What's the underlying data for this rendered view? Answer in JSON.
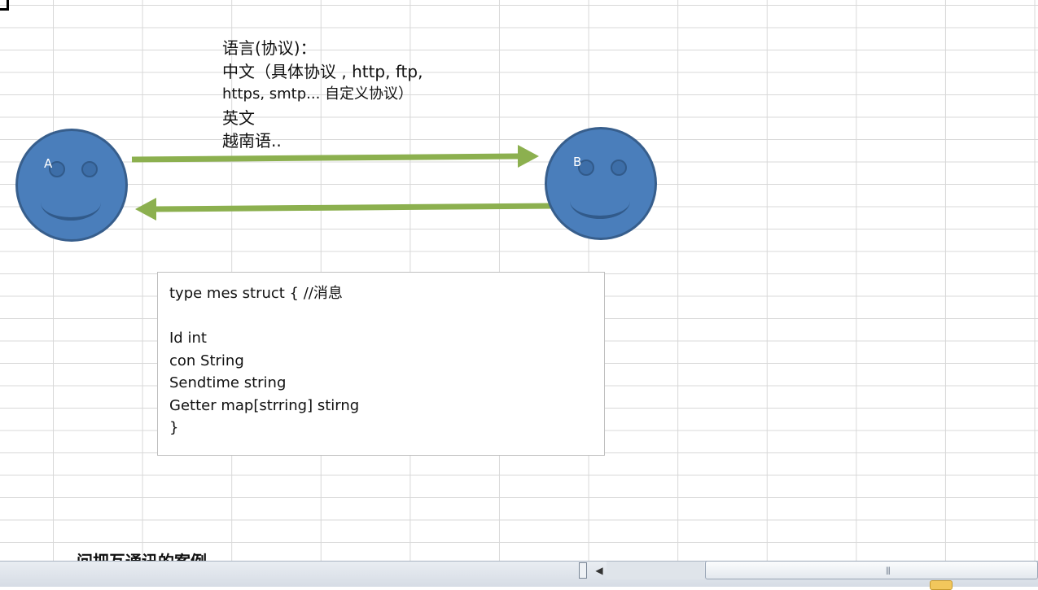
{
  "diagram": {
    "protocol_lines": [
      "语言(协议)：",
      "中文（具体协议 , http, ftp,",
      "https, smtp... 自定义协议）",
      "英文",
      "越南语.."
    ],
    "face_a_label": "A",
    "face_b_label": "B",
    "arrow_color": "#8cb04f",
    "face_color": "#4a7ebb"
  },
  "code_box": {
    "lines": [
      "type mes  struct {  //消息",
      "",
      "Id int",
      "con String",
      "Sendtime  string",
      "Getter  map[strring] stirng",
      "}"
    ]
  },
  "bottom_caption": "问把互通讯的案例"
}
